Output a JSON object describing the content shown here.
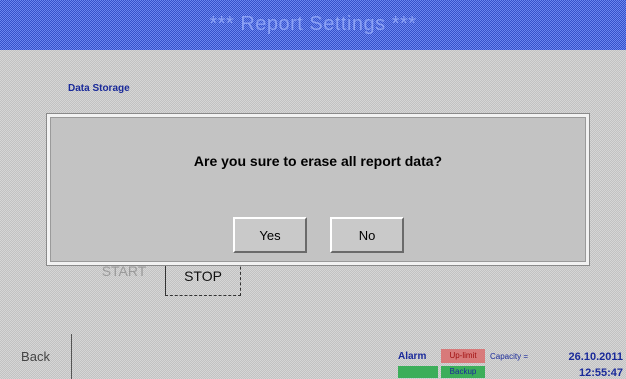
{
  "window": {
    "title": "*** Report Settings ***"
  },
  "section": {
    "label": "Data Storage"
  },
  "controls": {
    "start_label": "START",
    "stop_label": "STOP"
  },
  "nav": {
    "back_label": "Back"
  },
  "status": {
    "alarm_label": "Alarm",
    "alarm_badge": "Up-limit",
    "green_badge_2": "Backup",
    "capacity_label": "Capacity =",
    "date": "26.10.2011",
    "time": "12:55:47"
  },
  "dialog": {
    "message": "Are you sure to erase all report data?",
    "yes_label": "Yes",
    "no_label": "No"
  },
  "colors": {
    "title_bar": "#4060d8",
    "alarm_badge": "#d87a7a",
    "status_green": "#3cae5a",
    "label_blue": "#1a2a9a"
  }
}
